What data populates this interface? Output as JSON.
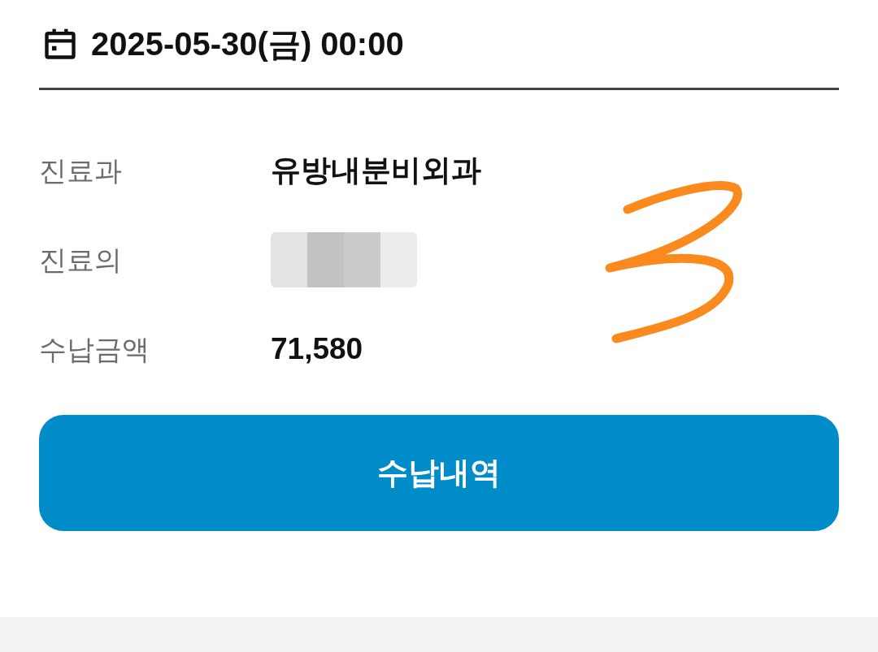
{
  "appointment": {
    "datetime": "2025-05-30(금) 00:00"
  },
  "details": [
    {
      "kind": "text",
      "label": "진료과",
      "value": "유방내분비외과"
    },
    {
      "kind": "redacted",
      "label": "진료의"
    },
    {
      "kind": "text",
      "label": "수납금액",
      "value": "71,580"
    }
  ],
  "button": {
    "label": "수납내역"
  }
}
